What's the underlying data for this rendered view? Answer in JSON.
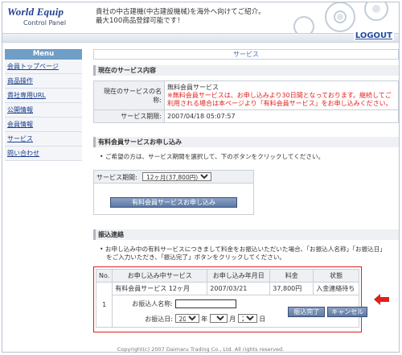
{
  "header": {
    "logo_main": "World Equip",
    "logo_sub": "Control Panel",
    "tagline_1": "貴社の中古建機(中古建設機械)を海外へ向けてご紹介。",
    "tagline_2": "最大100商品登録可能です！",
    "logout": "LOGOUT"
  },
  "sidebar": {
    "title": "Menu",
    "items": [
      {
        "label": "会員トップページ"
      },
      {
        "label": "商品操作"
      },
      {
        "label": "貴社専用URL"
      },
      {
        "label": "公開情報"
      },
      {
        "label": "会員情報"
      },
      {
        "label": "サービス"
      },
      {
        "label": "問い合わせ"
      }
    ]
  },
  "main": {
    "page_title": "サービス",
    "current": {
      "heading": "現在のサービス内容",
      "name_label": "現在のサービスの名称:",
      "name_value": "無料会員サービス",
      "name_warning": "※無料会員サービスは、お申し込みより30日間となっております。継続してご利用される場合は本ページより「有料会員サービス」をお申し込みください。",
      "period_label": "サービス期限:",
      "period_value": "2007/04/18 05:07:57"
    },
    "apply": {
      "heading": "有料会員サービスお申し込み",
      "note": "ご希望の方は、サービス期間を選択して、下のボタンをクリックしてください。",
      "period_label": "サービス期間:",
      "period_selected": "12ヶ月(37,800円)",
      "button": "有料会員サービスお申し込み"
    },
    "transfer": {
      "heading": "振込連絡",
      "note_1": "お申し込み中の有料サービスにつきまして料金をお振込いただいた場合、「お振込人名称」「お振込日」",
      "note_2": "をご入力いただき、「振込完了」ボタンをクリックしてください。",
      "columns": [
        "No.",
        "お申し込み中サービス",
        "お申し込み年月日",
        "料金",
        "状態"
      ],
      "row": {
        "no": "1",
        "service": "有料会員サービス 12ヶ月",
        "date": "2007/03/21",
        "fee": "37,800円",
        "status": "入金連絡待ち"
      },
      "payer_label": "お振込人名称:",
      "payer_value": "",
      "date_label": "お振込日:",
      "year": "2007",
      "year_unit": "年",
      "month": "3",
      "month_unit": "月",
      "day": "21",
      "day_unit": "日",
      "complete_button": "振込完了",
      "cancel_button": "キャンセル"
    }
  },
  "footer": {
    "copyright": "Copyright(c) 2007 Daimaru Trading Co., Ltd. All rights reserved."
  },
  "colors": {
    "accent": "#6f9ec7",
    "warning": "#e0201c",
    "highlight_border": "#e0201c",
    "button": "#5e7aa6"
  }
}
